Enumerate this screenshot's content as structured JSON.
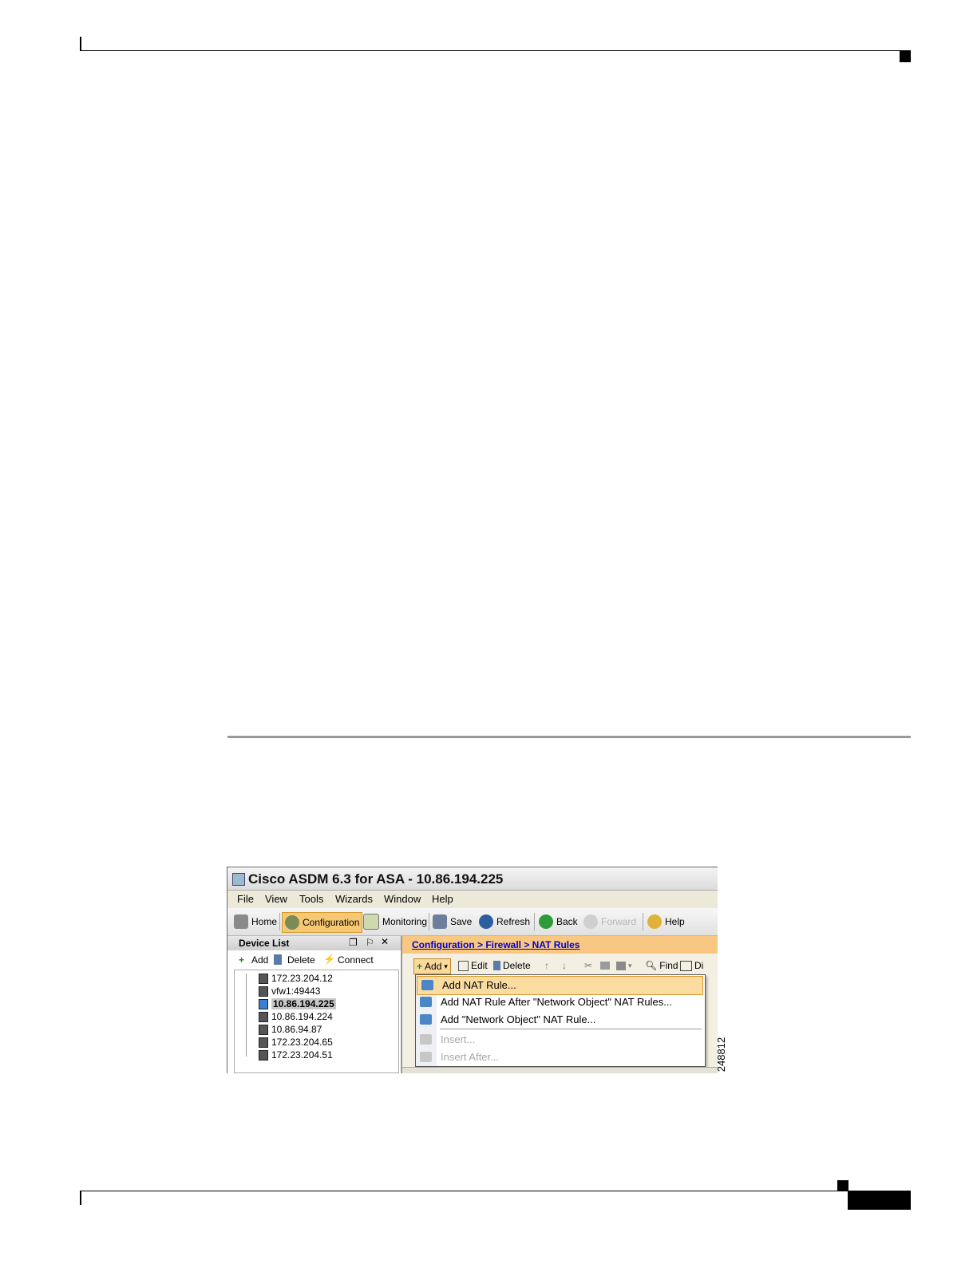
{
  "screenshot": {
    "title": "Cisco ASDM 6.3 for ASA - 10.86.194.225",
    "menu": [
      "File",
      "View",
      "Tools",
      "Wizards",
      "Window",
      "Help"
    ],
    "toolbar": {
      "home": "Home",
      "configuration": "Configuration",
      "monitoring": "Monitoring",
      "save": "Save",
      "refresh": "Refresh",
      "back": "Back",
      "forward": "Forward",
      "help": "Help"
    },
    "device_list": {
      "title": "Device List",
      "add": "Add",
      "delete": "Delete",
      "connect": "Connect",
      "items": [
        "172.23.204.12",
        "vfw1:49443",
        "10.86.194.225",
        "10.86.194.224",
        "10.86.94.87",
        "172.23.204.65",
        "172.23.204.51"
      ],
      "selected": "10.86.194.225"
    },
    "breadcrumb": "Configuration > Firewall > NAT Rules",
    "nat_toolbar": {
      "add": "Add",
      "edit": "Edit",
      "delete": "Delete",
      "find": "Find",
      "diagram": "Di"
    },
    "add_menu": [
      "Add NAT Rule...",
      "Add NAT Rule After \"Network Object\" NAT Rules...",
      "Add \"Network Object\" NAT Rule...",
      "Insert...",
      "Insert After..."
    ]
  },
  "figure_id": "248812",
  "colors": {
    "active_button": "#f7c873",
    "breadcrumb_bar": "#f8c781",
    "menu_highlight": "#fbdca0",
    "link": "#0000cc"
  }
}
